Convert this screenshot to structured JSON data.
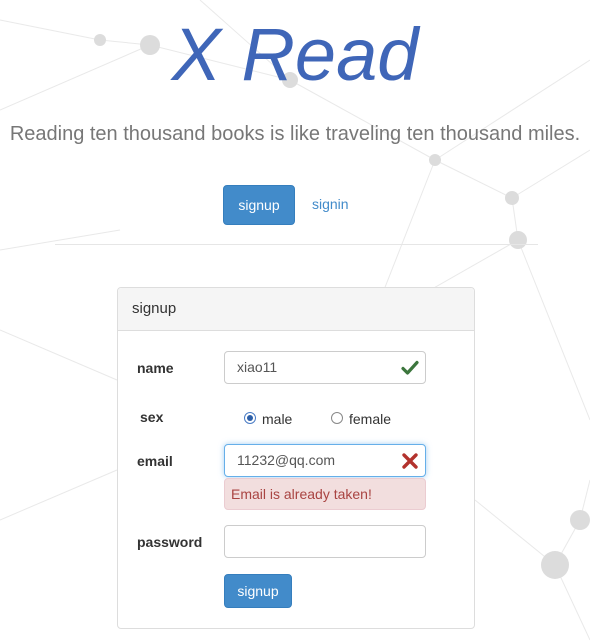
{
  "brand": {
    "title": "X Read"
  },
  "tagline": "Reading ten thousand books is like traveling ten thousand miles.",
  "nav": {
    "signup_label": "signup",
    "signin_label": "signin"
  },
  "colors": {
    "primary": "#428bca",
    "brand": "#3f66b8",
    "success": "#3c763d",
    "danger": "#a94442"
  },
  "form": {
    "panel_title": "signup",
    "name": {
      "label": "name",
      "value": "xiao11",
      "status_icon": "check-icon"
    },
    "sex": {
      "label": "sex",
      "options": [
        {
          "label": "male",
          "checked": true
        },
        {
          "label": "female",
          "checked": false
        }
      ]
    },
    "email": {
      "label": "email",
      "value": "11232@qq.com",
      "status_icon": "x-icon",
      "error": "Email is already taken!"
    },
    "password": {
      "label": "password",
      "value": ""
    },
    "submit_label": "signup"
  }
}
